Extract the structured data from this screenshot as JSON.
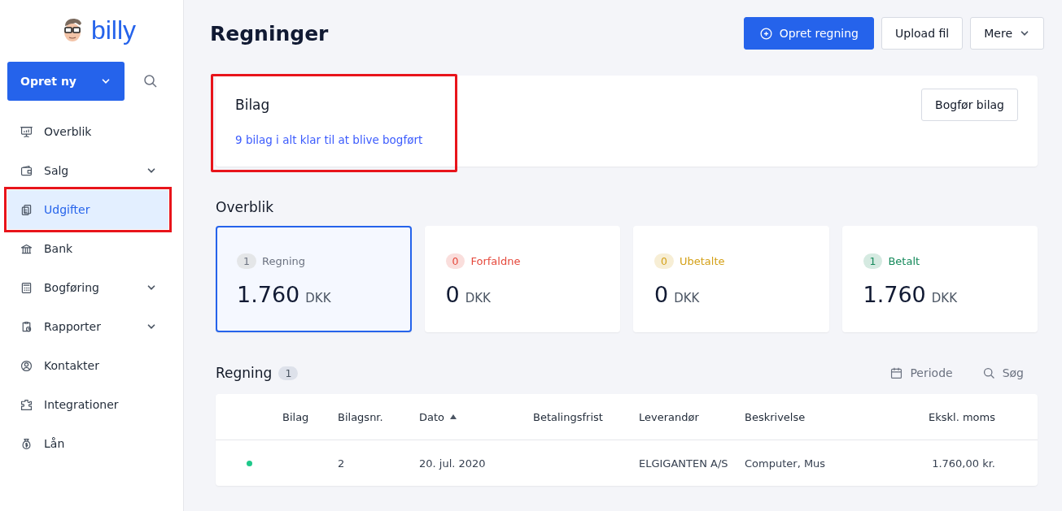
{
  "sidebar": {
    "logo": "billy",
    "create_button": "Opret ny",
    "items": [
      {
        "label": "Overblik",
        "expandable": false,
        "selected": false,
        "highlighted": false
      },
      {
        "label": "Salg",
        "expandable": true,
        "selected": false,
        "highlighted": false
      },
      {
        "label": "Udgifter",
        "expandable": false,
        "selected": true,
        "highlighted": true
      },
      {
        "label": "Bank",
        "expandable": false,
        "selected": false,
        "highlighted": false
      },
      {
        "label": "Bogføring",
        "expandable": true,
        "selected": false,
        "highlighted": false
      },
      {
        "label": "Rapporter",
        "expandable": true,
        "selected": false,
        "highlighted": false
      },
      {
        "label": "Kontakter",
        "expandable": false,
        "selected": false,
        "highlighted": false
      },
      {
        "label": "Integrationer",
        "expandable": false,
        "selected": false,
        "highlighted": false
      },
      {
        "label": "Lån",
        "expandable": false,
        "selected": false,
        "highlighted": false
      }
    ]
  },
  "header": {
    "title": "Regninger",
    "buttons": [
      {
        "label": "Opret regning",
        "kind": "primary"
      },
      {
        "label": "Upload fil",
        "kind": "secondary"
      },
      {
        "label": "Mere",
        "kind": "dropdown"
      }
    ]
  },
  "bilag": {
    "title": "Bilag",
    "link": "9 bilag i alt klar til at blive bogført",
    "button": "Bogfør bilag",
    "highlighted": true
  },
  "overview": {
    "title": "Overblik",
    "cards": [
      {
        "count": "1",
        "label": "Regning",
        "amount": "1.760",
        "currency": "DKK",
        "color": "#6b7280",
        "selected": true
      },
      {
        "count": "0",
        "label": "Forfaldne",
        "amount": "0",
        "currency": "DKK",
        "color": "#e5483b",
        "selected": false
      },
      {
        "count": "0",
        "label": "Ubetalte",
        "amount": "0",
        "currency": "DKK",
        "color": "#d4a017",
        "selected": false
      },
      {
        "count": "1",
        "label": "Betalt",
        "amount": "1.760",
        "currency": "DKK",
        "color": "#14895a",
        "selected": false
      }
    ]
  },
  "list": {
    "title": "Regning",
    "count": "1",
    "filters": [
      "Periode",
      "Søg"
    ],
    "table": {
      "columns": [
        {
          "label": "Bilag",
          "sorted": false
        },
        {
          "label": "Bilagsnr.",
          "sorted": false
        },
        {
          "label": "Dato",
          "sorted": true
        },
        {
          "label": "Betalingsfrist",
          "sorted": false
        },
        {
          "label": "Leverandør",
          "sorted": false
        },
        {
          "label": "Beskrivelse",
          "sorted": false
        },
        {
          "label": "Ekskl. moms",
          "sorted": false
        }
      ],
      "rows": [
        {
          "color": "#1ec88a",
          "cells": [
            null,
            "2",
            "20. jul. 2020",
            null,
            "ELGIGANTEN A/S",
            "Computer, Mus",
            "1.760,00 kr."
          ]
        }
      ]
    }
  }
}
